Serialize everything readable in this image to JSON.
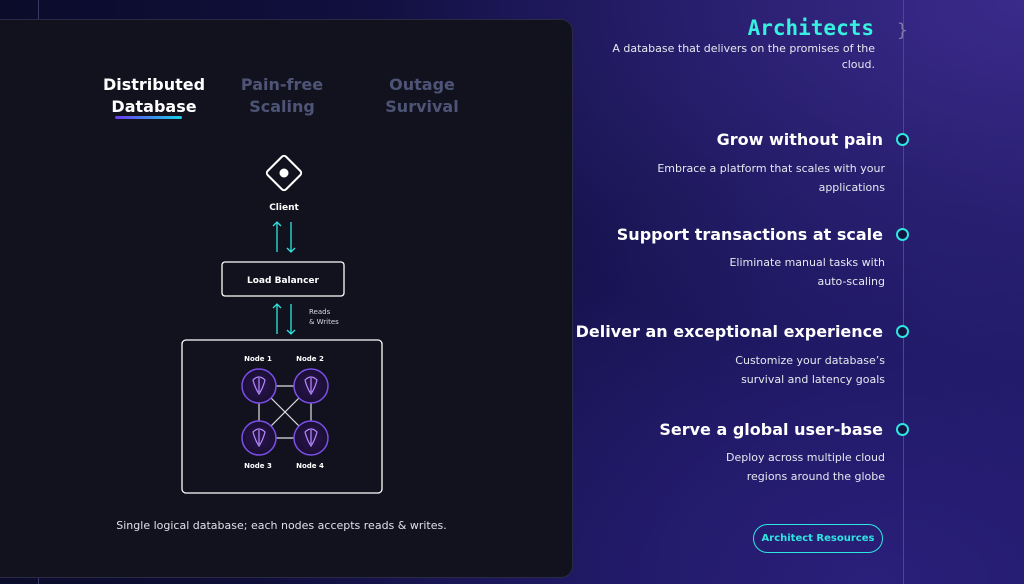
{
  "tabs": [
    {
      "line1": "Distributed",
      "line2": "Database"
    },
    {
      "line1": "Pain-free",
      "line2": "Scaling"
    },
    {
      "line1": "Outage",
      "line2": "Survival"
    }
  ],
  "diagram": {
    "client_label": "Client",
    "load_balancer_label": "Load Balancer",
    "reads_label_1": "Reads",
    "reads_label_2": "& Writes",
    "nodes": [
      "Node 1",
      "Node 2",
      "Node 3",
      "Node 4"
    ],
    "caption": "Single logical database; each nodes accepts reads & writes."
  },
  "architects": {
    "title": "Architects",
    "subtitle": "A database that delivers on the promises of the cloud."
  },
  "features": [
    {
      "title": "Grow without pain",
      "desc": "Embrace a platform that scales with your applications"
    },
    {
      "title": "Support transactions at scale",
      "desc": "Eliminate manual tasks with auto-scaling"
    },
    {
      "title": "Deliver an exceptional experience",
      "desc": "Customize your database’s survival and latency goals"
    },
    {
      "title": "Serve a global user-base",
      "desc": "Deploy across multiple cloud regions around the globe"
    }
  ],
  "resources_button": "Architect Resources",
  "colors": {
    "accent_cyan": "#2ee6e0",
    "accent_purple": "#7b4fe8",
    "card_bg": "#12121f"
  }
}
